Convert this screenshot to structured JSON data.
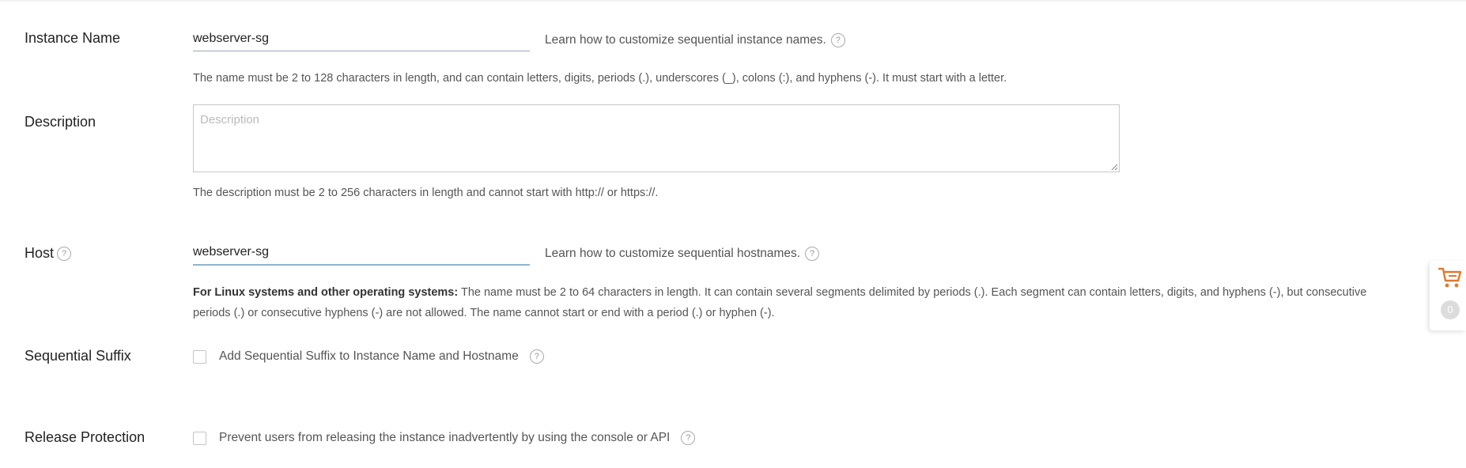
{
  "form": {
    "instance_name": {
      "label": "Instance Name",
      "value": "webserver-sg",
      "help_link": "Learn how to customize sequential instance names.",
      "hint": "The name must be 2 to 128 characters in length, and can contain letters, digits, periods (.), underscores (_), colons (:), and hyphens (-). It must start with a letter."
    },
    "description": {
      "label": "Description",
      "placeholder": "Description",
      "value": "",
      "hint": "The description must be 2 to 256 characters in length and cannot start with http:// or https://."
    },
    "host": {
      "label": "Host",
      "value": "webserver-sg",
      "help_link": "Learn how to customize sequential hostnames.",
      "hint_bold": "For Linux systems and other operating systems:",
      "hint": " The name must be 2 to 64 characters in length. It can contain several segments delimited by periods (.). Each segment can contain letters, digits, and hyphens (-), but consecutive periods (.) or consecutive hyphens (-) are not allowed. The name cannot start or end with a period (.) or hyphen (-)."
    },
    "sequential_suffix": {
      "label": "Sequential Suffix",
      "checkbox_label": "Add Sequential Suffix to Instance Name and Hostname",
      "checked": false
    },
    "release_protection": {
      "label": "Release Protection",
      "checkbox_label": "Prevent users from releasing the instance inadvertently by using the console or API",
      "checked": false
    }
  },
  "help_icon_glyph": "?",
  "cart": {
    "icon": "shopping-cart-icon",
    "count": "0",
    "color": "#e07a2e"
  }
}
